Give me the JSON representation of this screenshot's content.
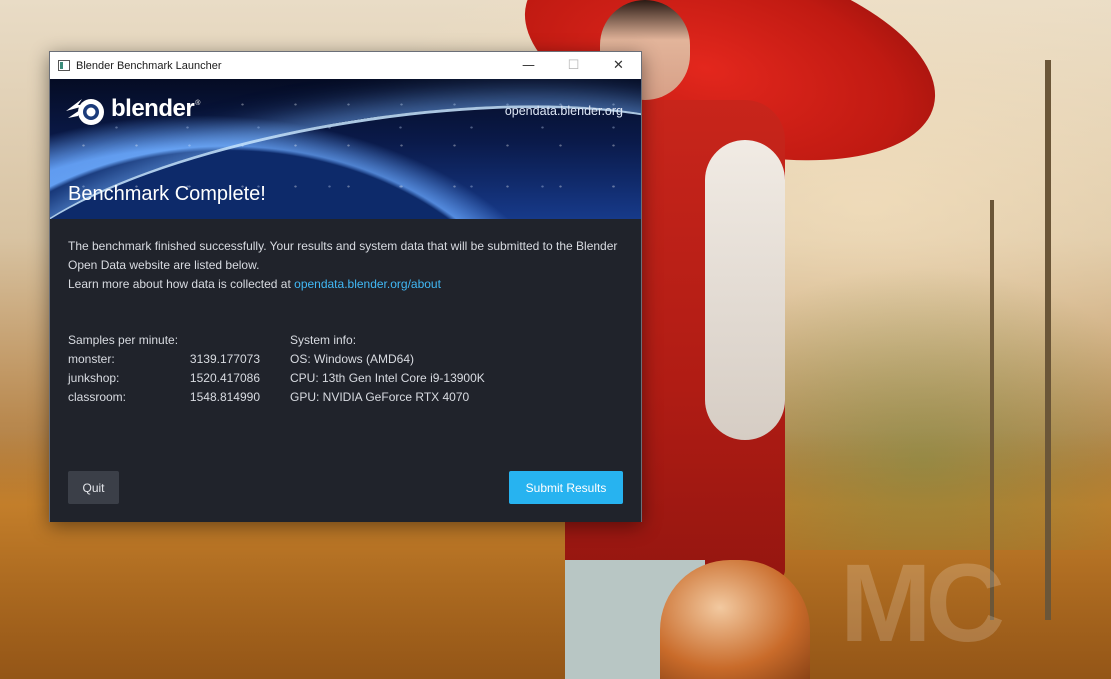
{
  "window": {
    "title": "Blender Benchmark Launcher",
    "controls": {
      "minimize": "—",
      "maximize": "☐",
      "close": "✕"
    }
  },
  "banner": {
    "logo_text": "blender",
    "logo_reg": "®",
    "site_link": "opendata.blender.org",
    "heading": "Benchmark Complete!"
  },
  "intro": {
    "line1": "The benchmark finished successfully. Your results and system data that will be submitted to the Blender Open Data website are listed below.",
    "learn_more": "Learn more about how data is collected at ",
    "learn_more_link": "opendata.blender.org/about"
  },
  "results": {
    "header": "Samples per minute:",
    "rows": [
      {
        "name": "monster:",
        "value": "3139.177073"
      },
      {
        "name": "junkshop:",
        "value": "1520.417086"
      },
      {
        "name": "classroom:",
        "value": "1548.814990"
      }
    ]
  },
  "system": {
    "header": "System info:",
    "os": "OS: Windows (AMD64)",
    "cpu": "CPU: 13th Gen Intel Core i9-13900K",
    "gpu": "GPU: NVIDIA GeForce RTX 4070"
  },
  "buttons": {
    "quit": "Quit",
    "submit": "Submit Results"
  },
  "colors": {
    "accent": "#27b3f0",
    "link": "#41b8f5",
    "panel_bg": "#20232b"
  },
  "wallpaper": {
    "watermark": "MC"
  }
}
